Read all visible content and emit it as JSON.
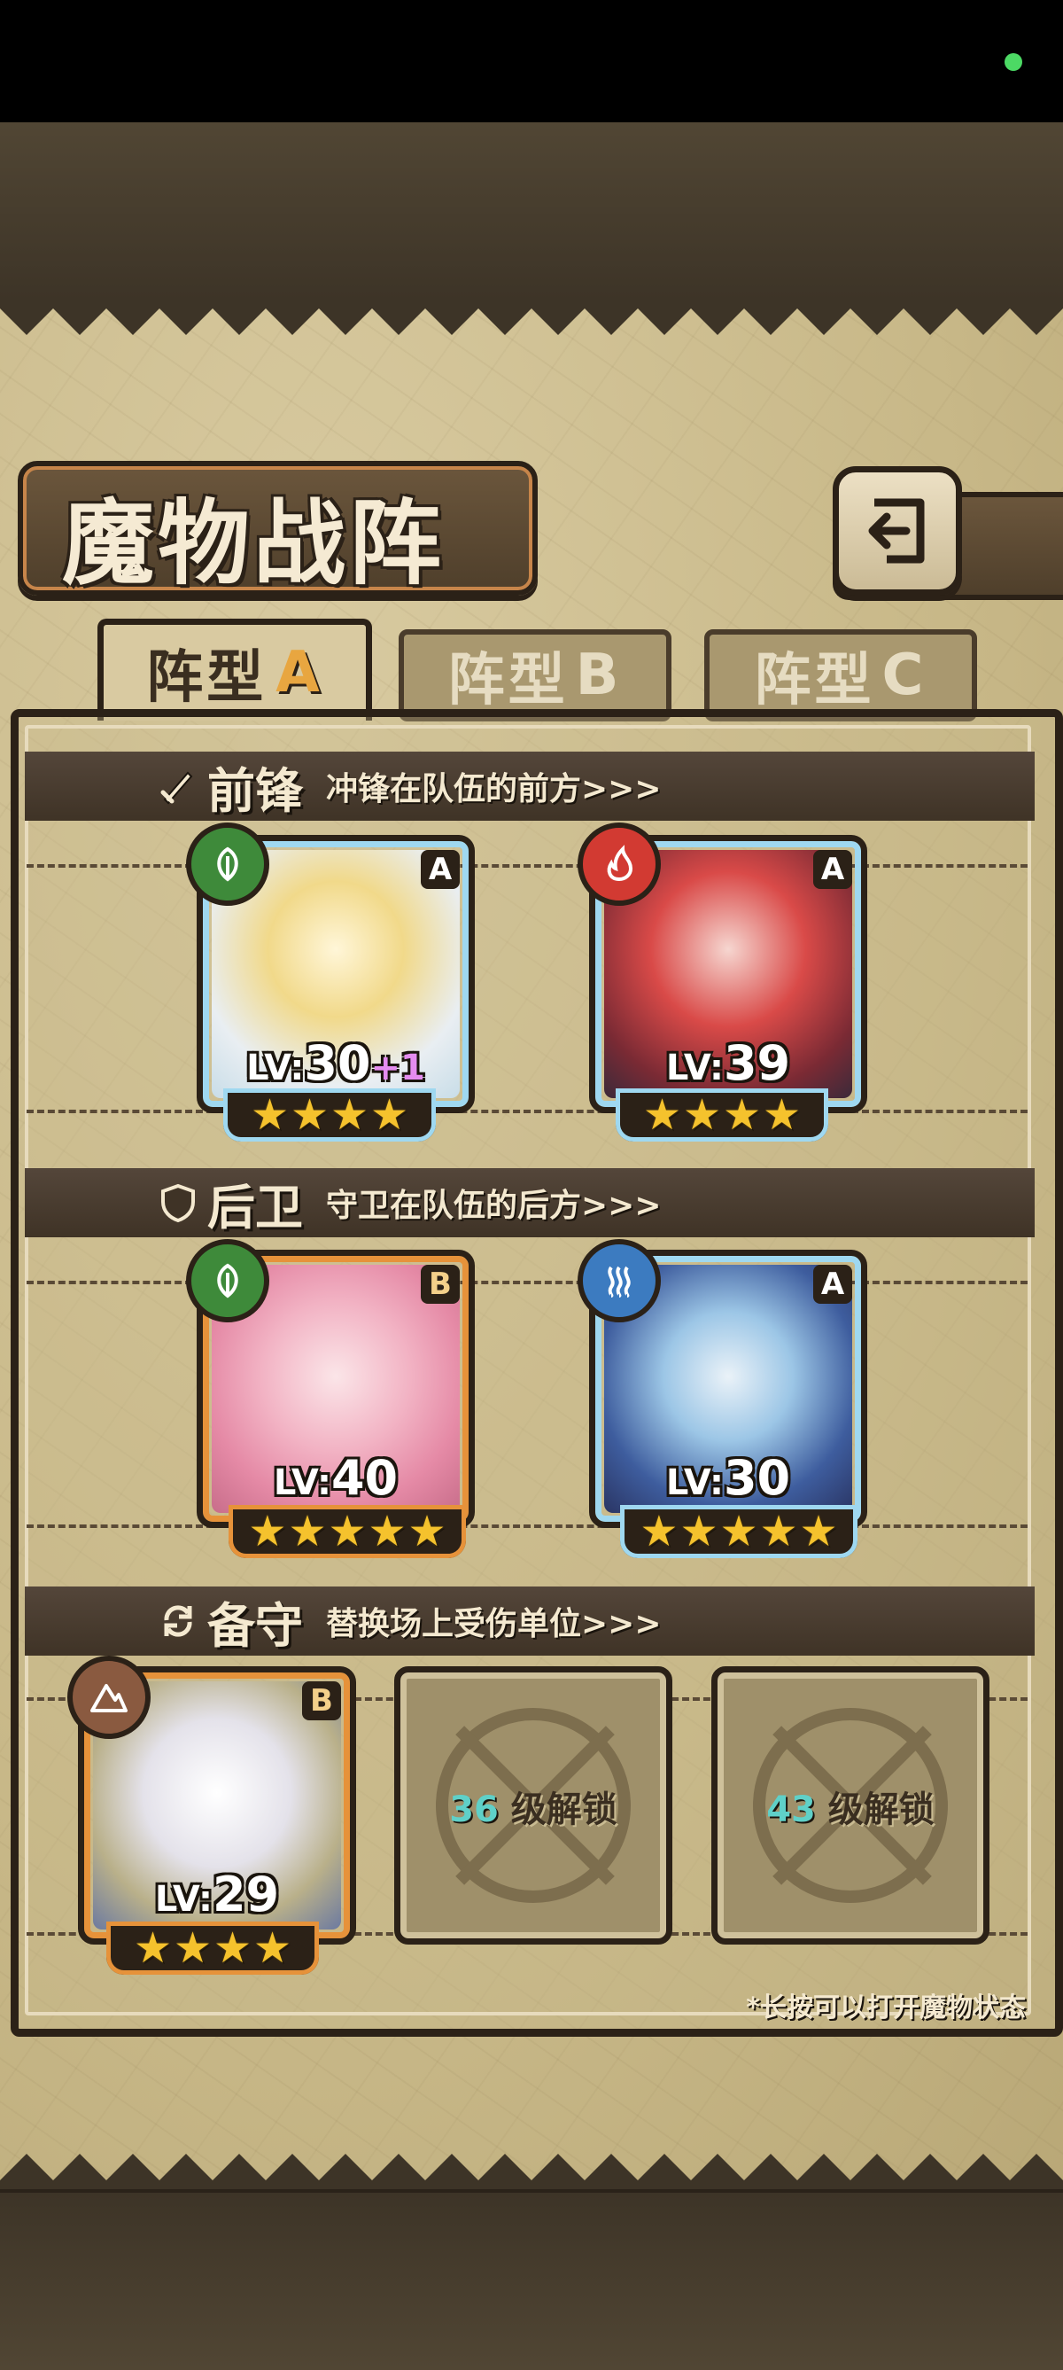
{
  "title": "魔物战阵",
  "tabs": [
    {
      "label": "阵型",
      "letter": "A",
      "active": true
    },
    {
      "label": "阵型",
      "letter": "B",
      "active": false
    },
    {
      "label": "阵型",
      "letter": "C",
      "active": false
    }
  ],
  "sections": {
    "front": {
      "title": "前锋",
      "desc": "冲锋在队伍的前方>>>"
    },
    "rear": {
      "title": "后卫",
      "desc": "守卫在队伍的后方>>>"
    },
    "reserve": {
      "title": "备守",
      "desc": "替换场上受伤单位>>>"
    }
  },
  "units": [
    {
      "slot": "front-1",
      "element": "nature",
      "rank": "A",
      "level_prefix": "LV:",
      "level": "30",
      "bonus": "+1",
      "stars": 4
    },
    {
      "slot": "front-2",
      "element": "fire",
      "rank": "A",
      "level_prefix": "LV:",
      "level": "39",
      "bonus": "",
      "stars": 4
    },
    {
      "slot": "rear-1",
      "element": "nature",
      "rank": "B",
      "level_prefix": "LV:",
      "level": "40",
      "bonus": "",
      "stars": 5
    },
    {
      "slot": "rear-2",
      "element": "water",
      "rank": "A",
      "level_prefix": "LV:",
      "level": "30",
      "bonus": "",
      "stars": 5
    },
    {
      "slot": "reserve-1",
      "element": "earth",
      "rank": "B",
      "level_prefix": "LV:",
      "level": "29",
      "bonus": "",
      "stars": 4
    }
  ],
  "locked_slots": [
    {
      "level": "36",
      "text": "级解锁"
    },
    {
      "level": "43",
      "text": "级解锁"
    }
  ],
  "hint": "*长按可以打开魔物状态",
  "icons": [
    "back-arrow-icon",
    "sword-icon",
    "shield-icon",
    "swap-icon",
    "leaf-icon",
    "flame-icon",
    "water-icon",
    "mountain-icon",
    "star-icon"
  ],
  "colors": {
    "rank_a": "#9fd8f0",
    "rank_b": "#e6923a",
    "star": "#f5c22d",
    "unlock_level": "#5fd0c8"
  }
}
